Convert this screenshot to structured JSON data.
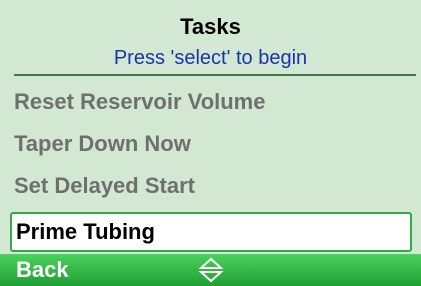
{
  "header": {
    "title": "Tasks",
    "subtitle": "Press 'select' to begin"
  },
  "menu": {
    "items": [
      {
        "label": "Reset Reservoir Volume",
        "selected": false
      },
      {
        "label": "Taper Down Now",
        "selected": false
      },
      {
        "label": "Set Delayed Start",
        "selected": false
      },
      {
        "label": "Prime Tubing",
        "selected": true
      }
    ]
  },
  "footer": {
    "back_label": "Back",
    "nav_icon": "up-down-arrows-icon"
  },
  "colors": {
    "background": "#d3e8d2",
    "subtitle": "#1a34a8",
    "footer": "#2fb545",
    "unselected_text": "#6f6f6f"
  }
}
